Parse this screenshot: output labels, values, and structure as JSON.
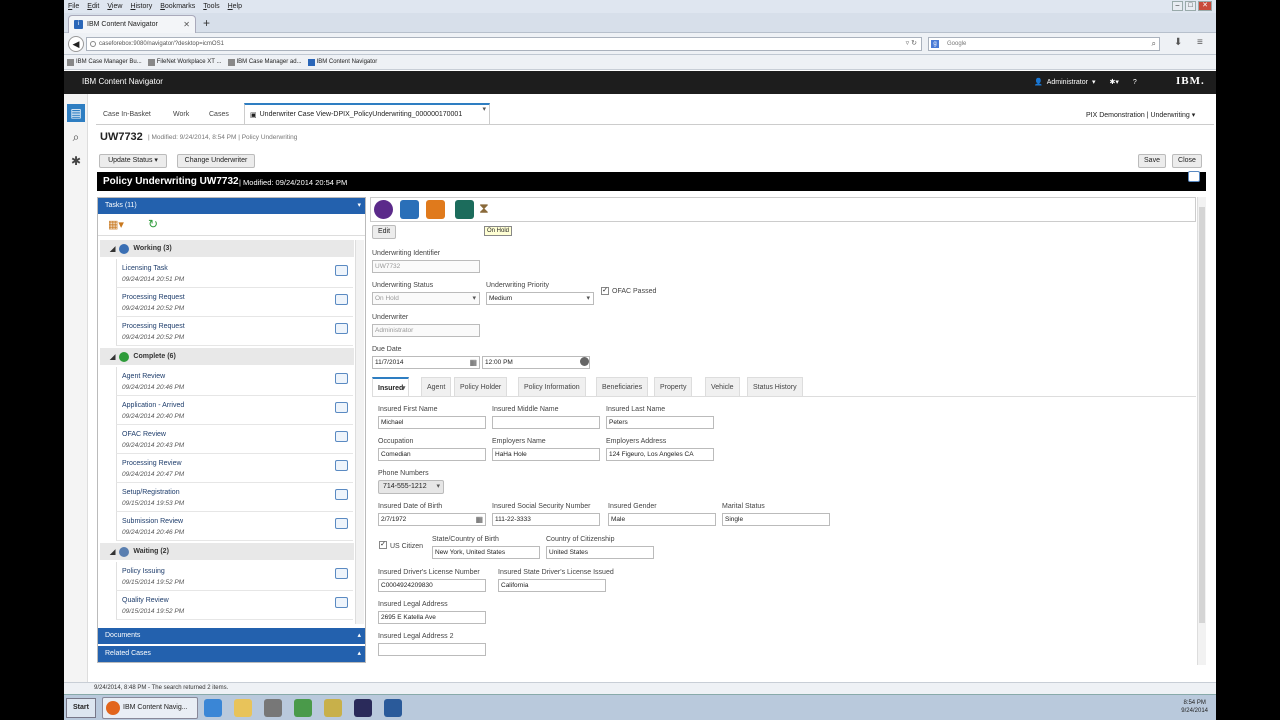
{
  "browser": {
    "menu": [
      "File",
      "Edit",
      "View",
      "History",
      "Bookmarks",
      "Tools",
      "Help"
    ],
    "tab_title": "IBM Content Navigator",
    "url": "caseforebox:9080/navigator/?desktop=icmOS1",
    "search_placeholder": "Google",
    "bookmarks": [
      "IBM Case Manager Bu...",
      "FileNet Workplace XT ...",
      "IBM Case Manager ad...",
      "IBM Content Navigator"
    ]
  },
  "app": {
    "title": "IBM Content Navigator",
    "user": "Administrator",
    "logo": "IBM.",
    "tabs": [
      "Case In-Basket",
      "Work",
      "Cases",
      "Underwriter Case View-DPIX_PolicyUnderwriting_000000170001"
    ],
    "context": "PIX Demonstration | Underwriting",
    "case_id": "UW7732",
    "case_meta": "| Modified: 9/24/2014, 8:54 PM | Policy Underwriting",
    "actions": {
      "update_status": "Update Status",
      "change_underwriter": "Change Underwriter",
      "save": "Save",
      "close": "Close"
    },
    "case_header_title": "Policy Underwriting UW7732",
    "case_header_meta": "| Modified: 09/24/2014 20:54 PM"
  },
  "tasks": {
    "header": "Tasks (11)",
    "groups": [
      {
        "label": "Working (3)",
        "color": "#3a6fb4",
        "items": [
          {
            "name": "Licensing Task",
            "date": "09/24/2014 20:51 PM"
          },
          {
            "name": "Processing Request",
            "date": "09/24/2014 20:52 PM"
          },
          {
            "name": "Processing Request",
            "date": "09/24/2014 20:52 PM"
          }
        ]
      },
      {
        "label": "Complete (6)",
        "color": "#2e9b3a",
        "items": [
          {
            "name": "Agent Review",
            "date": "09/24/2014 20:46 PM"
          },
          {
            "name": "Application - Arrived",
            "date": "09/24/2014 20:40 PM"
          },
          {
            "name": "OFAC Review",
            "date": "09/24/2014 20:43 PM"
          },
          {
            "name": "Processing Review",
            "date": "09/24/2014 20:47 PM"
          },
          {
            "name": "Setup/Registration",
            "date": "09/15/2014 19:53 PM"
          },
          {
            "name": "Submission Review",
            "date": "09/24/2014 20:46 PM"
          }
        ]
      },
      {
        "label": "Waiting (2)",
        "color": "#5a7fb0",
        "items": [
          {
            "name": "Policy Issuing",
            "date": "09/15/2014 19:52 PM"
          },
          {
            "name": "Quality Review",
            "date": "09/15/2014 19:52 PM"
          }
        ]
      }
    ],
    "documents": "Documents",
    "related_cases": "Related Cases"
  },
  "form": {
    "tooltip": "On Hold",
    "edit": "Edit",
    "uw_id_label": "Underwriting Identifier",
    "uw_id": "UW7732",
    "status_label": "Underwriting Status",
    "status": "On Hold",
    "priority_label": "Underwriting Priority",
    "priority": "Medium",
    "ofac_label": "OFAC Passed",
    "underwriter_label": "Underwriter",
    "underwriter": "Administrator",
    "due_label": "Due Date",
    "due_date": "11/7/2014",
    "due_time": "12:00 PM",
    "tabs": [
      "Insured",
      "Agent",
      "Policy Holder",
      "Policy Information",
      "Beneficiaries",
      "Property",
      "Vehicle",
      "Status History"
    ],
    "first_name_label": "Insured First Name",
    "first_name": "Michael",
    "middle_name_label": "Insured Middle Name",
    "middle_name": "",
    "last_name_label": "Insured Last Name",
    "last_name": "Peters",
    "occupation_label": "Occupation",
    "occupation": "Comedian",
    "employer_label": "Employers Name",
    "employer": "HaHa Hole",
    "employer_addr_label": "Employers Address",
    "employer_addr": "124 Figeuro, Los Angeles CA",
    "phone_label": "Phone Numbers",
    "phone": "714-555-1212",
    "dob_label": "Insured Date of Birth",
    "dob": "2/7/1972",
    "ssn_label": "Insured Social Security Number",
    "ssn": "111-22-3333",
    "gender_label": "Insured Gender",
    "gender": "Male",
    "marital_label": "Marital Status",
    "marital": "Single",
    "us_citizen_label": "US Citizen",
    "birth_label": "State/Country of Birth",
    "birth": "New York, United States",
    "citizenship_label": "Country of Citizenship",
    "citizenship": "United States",
    "license_label": "Insured Driver's License Number",
    "license": "C0004924209830",
    "license_state_label": "Insured State Driver's License Issued",
    "license_state": "California",
    "address_label": "Insured Legal Address",
    "address": "2695 E Katella Ave",
    "address2_label": "Insured Legal Address 2",
    "address2": ""
  },
  "status_bar": "9/24/2014, 8:48 PM - The search returned 2 items.",
  "taskbar": {
    "start": "Start",
    "app": "IBM Content Navig...",
    "time": "8:54 PM",
    "date": "9/24/2014"
  }
}
